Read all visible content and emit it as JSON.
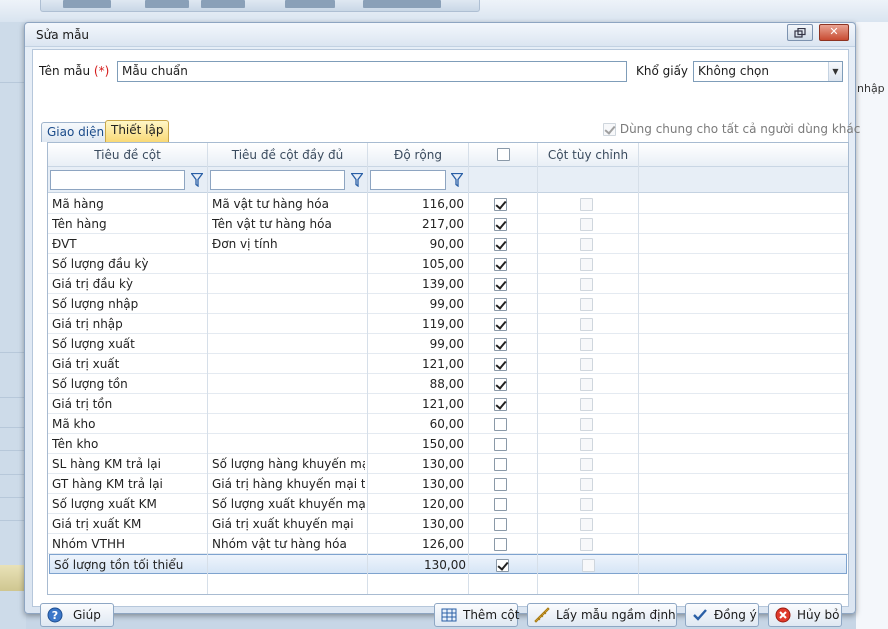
{
  "dialog": {
    "title": "Sửa mẫu",
    "template_name_label": "Tên mẫu",
    "required_mark": "(*)",
    "template_name_value": "Mẫu chuẩn",
    "paper_size_label": "Khổ giấy",
    "paper_size_value": "Không chọn",
    "tabs": [
      {
        "label": "Giao diện",
        "active": false
      },
      {
        "label": "Thiết lập",
        "active": true
      }
    ],
    "share_label": "Dùng chung cho tất cả người dùng khác",
    "share_checked": true
  },
  "background": {
    "right_label": "nhập"
  },
  "grid": {
    "columns": [
      "Tiêu đề cột",
      "Tiêu đề cột đầy đủ",
      "Độ rộng",
      "",
      "Cột tùy chỉnh"
    ],
    "rows": [
      {
        "title": "Mã hàng",
        "full": "Mã vật tư hàng hóa",
        "width": "116,00",
        "show": true
      },
      {
        "title": "Tên hàng",
        "full": "Tên vật tư hàng hóa",
        "width": "217,00",
        "show": true
      },
      {
        "title": "ĐVT",
        "full": "Đơn vị tính",
        "width": "90,00",
        "show": true
      },
      {
        "title": "Số lượng đầu kỳ",
        "full": "",
        "width": "105,00",
        "show": true
      },
      {
        "title": "Giá trị đầu kỳ",
        "full": "",
        "width": "139,00",
        "show": true
      },
      {
        "title": "Số lượng nhập",
        "full": "",
        "width": "99,00",
        "show": true
      },
      {
        "title": "Giá trị nhập",
        "full": "",
        "width": "119,00",
        "show": true
      },
      {
        "title": "Số lượng xuất",
        "full": "",
        "width": "99,00",
        "show": true
      },
      {
        "title": "Giá trị xuất",
        "full": "",
        "width": "121,00",
        "show": true
      },
      {
        "title": "Số lượng tồn",
        "full": "",
        "width": "88,00",
        "show": true
      },
      {
        "title": "Giá trị tồn",
        "full": "",
        "width": "121,00",
        "show": true
      },
      {
        "title": "Mã kho",
        "full": "",
        "width": "60,00",
        "show": false
      },
      {
        "title": "Tên kho",
        "full": "",
        "width": "150,00",
        "show": false
      },
      {
        "title": "SL hàng KM trả lại",
        "full": "Số lượng hàng khuyến mại",
        "width": "130,00",
        "show": false
      },
      {
        "title": "GT hàng KM trả lại",
        "full": "Giá trị hàng khuyến mại trả",
        "width": "130,00",
        "show": false
      },
      {
        "title": "Số lượng xuất KM",
        "full": "Số lượng xuất khuyến mại",
        "width": "120,00",
        "show": false
      },
      {
        "title": "Giá trị xuất KM",
        "full": "Giá trị xuất khuyến mại",
        "width": "130,00",
        "show": false
      },
      {
        "title": "Nhóm VTHH",
        "full": "Nhóm vật tư hàng hóa",
        "width": "126,00",
        "show": false
      },
      {
        "title": "Số lượng tồn tối thiểu",
        "full": "",
        "width": "130,00",
        "show": true,
        "selected": true
      }
    ]
  },
  "buttons": {
    "help": "Giúp",
    "add_column": "Thêm cột",
    "default_template": "Lấy mẫu ngầm định",
    "ok": "Đồng ý",
    "cancel": "Hủy bỏ"
  },
  "colors": {
    "accent": "#1a4b8a",
    "selected_row": "#d6e5f6",
    "required": "#d51b1b"
  }
}
